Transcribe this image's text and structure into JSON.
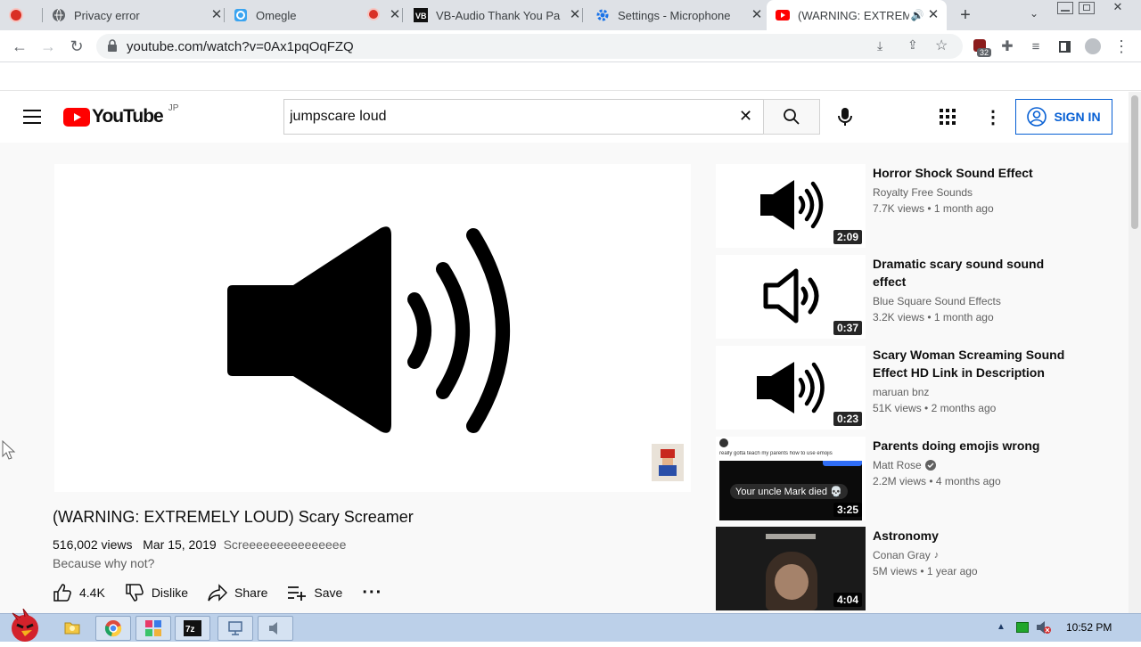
{
  "tabs": [
    {
      "title": "",
      "icon": "recording-dot-icon"
    },
    {
      "title": "Privacy error",
      "icon": "globe-icon"
    },
    {
      "title": "Omegle",
      "icon": "omegle-icon"
    },
    {
      "title": "",
      "icon": "recording-dot-icon"
    },
    {
      "title": "VB-Audio Thank You Pa",
      "icon": "vb-audio-icon"
    },
    {
      "title": "Settings - Microphone",
      "icon": "settings-gear-icon"
    },
    {
      "title": "(WARNING: EXTREM",
      "icon": "youtube-icon",
      "active": true
    }
  ],
  "address": {
    "url": "youtube.com/watch?v=0Ax1pqOqFZQ"
  },
  "extension_badge": "32",
  "youtube": {
    "logo_text": "YouTube",
    "region": "JP",
    "search_value": "jumpscare loud",
    "signin_label": "SIGN IN"
  },
  "video": {
    "title": "(WARNING: EXTREMELY LOUD) Scary Screamer",
    "views": "516,002 views",
    "date": "Mar 15, 2019",
    "tags": "Screeeeeeeeeeeeeee",
    "description": "Because why not?",
    "likes": "4.4K",
    "dislike_label": "Dislike",
    "share_label": "Share",
    "save_label": "Save"
  },
  "recommendations": [
    {
      "title": "Horror Shock Sound Effect",
      "channel": "Royalty Free Sounds",
      "views": "7.7K views",
      "age": "1 month ago",
      "duration": "2:09",
      "verified": false
    },
    {
      "title": "Dramatic scary sound sound effect",
      "channel": "Blue Square Sound Effects",
      "views": "3.2K views",
      "age": "1 month ago",
      "duration": "0:37",
      "verified": false
    },
    {
      "title": "Scary Woman Screaming Sound Effect HD Link in Description",
      "channel": "maruan bnz",
      "views": "51K views",
      "age": "2 months ago",
      "duration": "0:23",
      "verified": false
    },
    {
      "title": "Parents doing emojis wrong",
      "channel": "Matt Rose",
      "views": "2.2M views",
      "age": "4 months ago",
      "duration": "3:25",
      "verified": true,
      "thumb_caption": "really gotta teach my parents how to use emojis",
      "thumb_bubble": "Your uncle Mark died 💀"
    },
    {
      "title": "Astronomy",
      "channel": "Conan Gray",
      "views": "5M views",
      "age": "1 year ago",
      "duration": "4:04",
      "verified": false,
      "music": true
    }
  ],
  "taskbar": {
    "clock": "10:52 PM"
  },
  "colors": {
    "accent_blue": "#065fd4",
    "youtube_red": "#ff0000",
    "tab_strip": "#dee1e6",
    "taskbar": "#bcd0e9"
  }
}
